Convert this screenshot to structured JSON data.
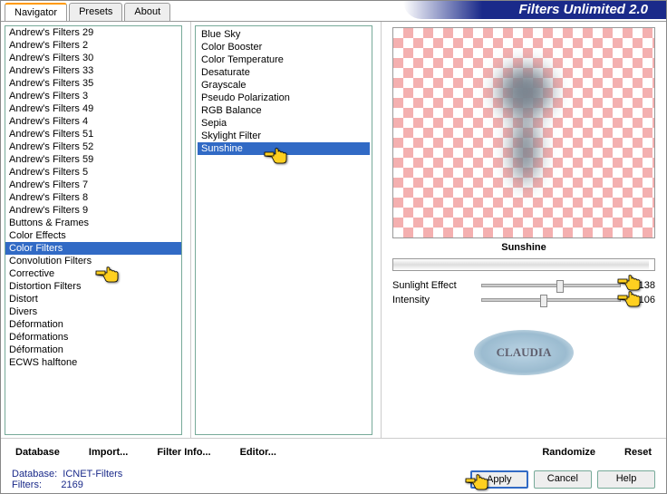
{
  "title": "Filters Unlimited 2.0",
  "tabs": [
    {
      "label": "Navigator",
      "active": true
    },
    {
      "label": "Presets",
      "active": false
    },
    {
      "label": "About",
      "active": false
    }
  ],
  "categories": [
    "Andrew's Filters 29",
    "Andrew's Filters 2",
    "Andrew's Filters 30",
    "Andrew's Filters 33",
    "Andrew's Filters 35",
    "Andrew's Filters 3",
    "Andrew's Filters 49",
    "Andrew's Filters 4",
    "Andrew's Filters 51",
    "Andrew's Filters 52",
    "Andrew's Filters 59",
    "Andrew's Filters 5",
    "Andrew's Filters 7",
    "Andrew's Filters 8",
    "Andrew's Filters 9",
    "Buttons & Frames",
    "Color Effects",
    "Color Filters",
    "Convolution Filters",
    "Corrective",
    "Distortion Filters",
    "Distort",
    "Divers",
    "Déformation",
    "Déformations",
    "Déformation",
    "ECWS halftone"
  ],
  "selected_category_index": 17,
  "filters": [
    "Blue Sky",
    "Color Booster",
    "Color Temperature",
    "Desaturate",
    "Grayscale",
    "Pseudo Polarization",
    "RGB Balance",
    "Sepia",
    "Skylight Filter",
    "Sunshine"
  ],
  "selected_filter_index": 9,
  "preview_label": "Sunshine",
  "sliders": [
    {
      "label": "Sunlight Effect",
      "value": 138,
      "pos": 54
    },
    {
      "label": "Intensity",
      "value": 106,
      "pos": 42
    }
  ],
  "buttons_row1": [
    "Database",
    "Import...",
    "Filter Info...",
    "Editor..."
  ],
  "buttons_row1_right": [
    "Randomize",
    "Reset"
  ],
  "footer": {
    "db_label": "Database:",
    "db_value": "ICNET-Filters",
    "filters_label": "Filters:",
    "filters_value": "2169"
  },
  "footer_buttons": [
    "Apply",
    "Cancel",
    "Help"
  ],
  "watermark": "CLAUDIA"
}
